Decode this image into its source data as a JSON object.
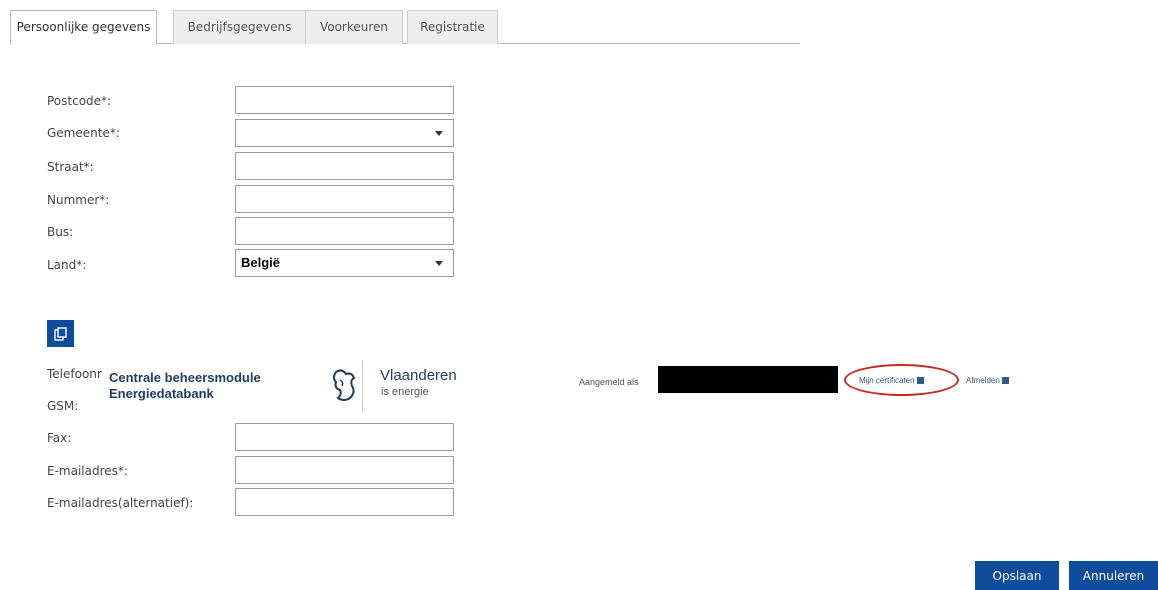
{
  "tabs": [
    {
      "label": "Persoonlijke gegevens",
      "active": true
    },
    {
      "label": "Bedrijfsgegevens",
      "active": false
    },
    {
      "label": "Voorkeuren",
      "active": false
    },
    {
      "label": "Registratie",
      "active": false
    }
  ],
  "address": {
    "postcode_label": "Postcode*:",
    "gemeente_label": "Gemeente*:",
    "gemeente_value": "",
    "straat_label": "Straat*:",
    "nummer_label": "Nummer*:",
    "bus_label": "Bus:",
    "land_label": "Land*:",
    "land_value": "België"
  },
  "contact": {
    "telefoon_label": "Telefoonr",
    "gsm_label": "GSM:",
    "fax_label": "Fax:",
    "email_label": "E-mailadres*:",
    "email_alt_label": "E-mailadres(alternatief):"
  },
  "copy_button": {
    "icon": "copy-icon"
  },
  "banner": {
    "app_name_line1": "Centrale beheersmodule",
    "app_name_line2": "Energiedatabank",
    "brand_title": "Vlaanderen",
    "brand_subtitle": "is energie",
    "logged_in_label": "Aangemeld als",
    "certificates_link": "Mijn certificaten",
    "logout_link": "Afmelden",
    "highlight_color": "#c62828"
  },
  "actions": {
    "save_label": "Opslaan",
    "cancel_label": "Annuleren",
    "accent": "#0d4d9c"
  }
}
